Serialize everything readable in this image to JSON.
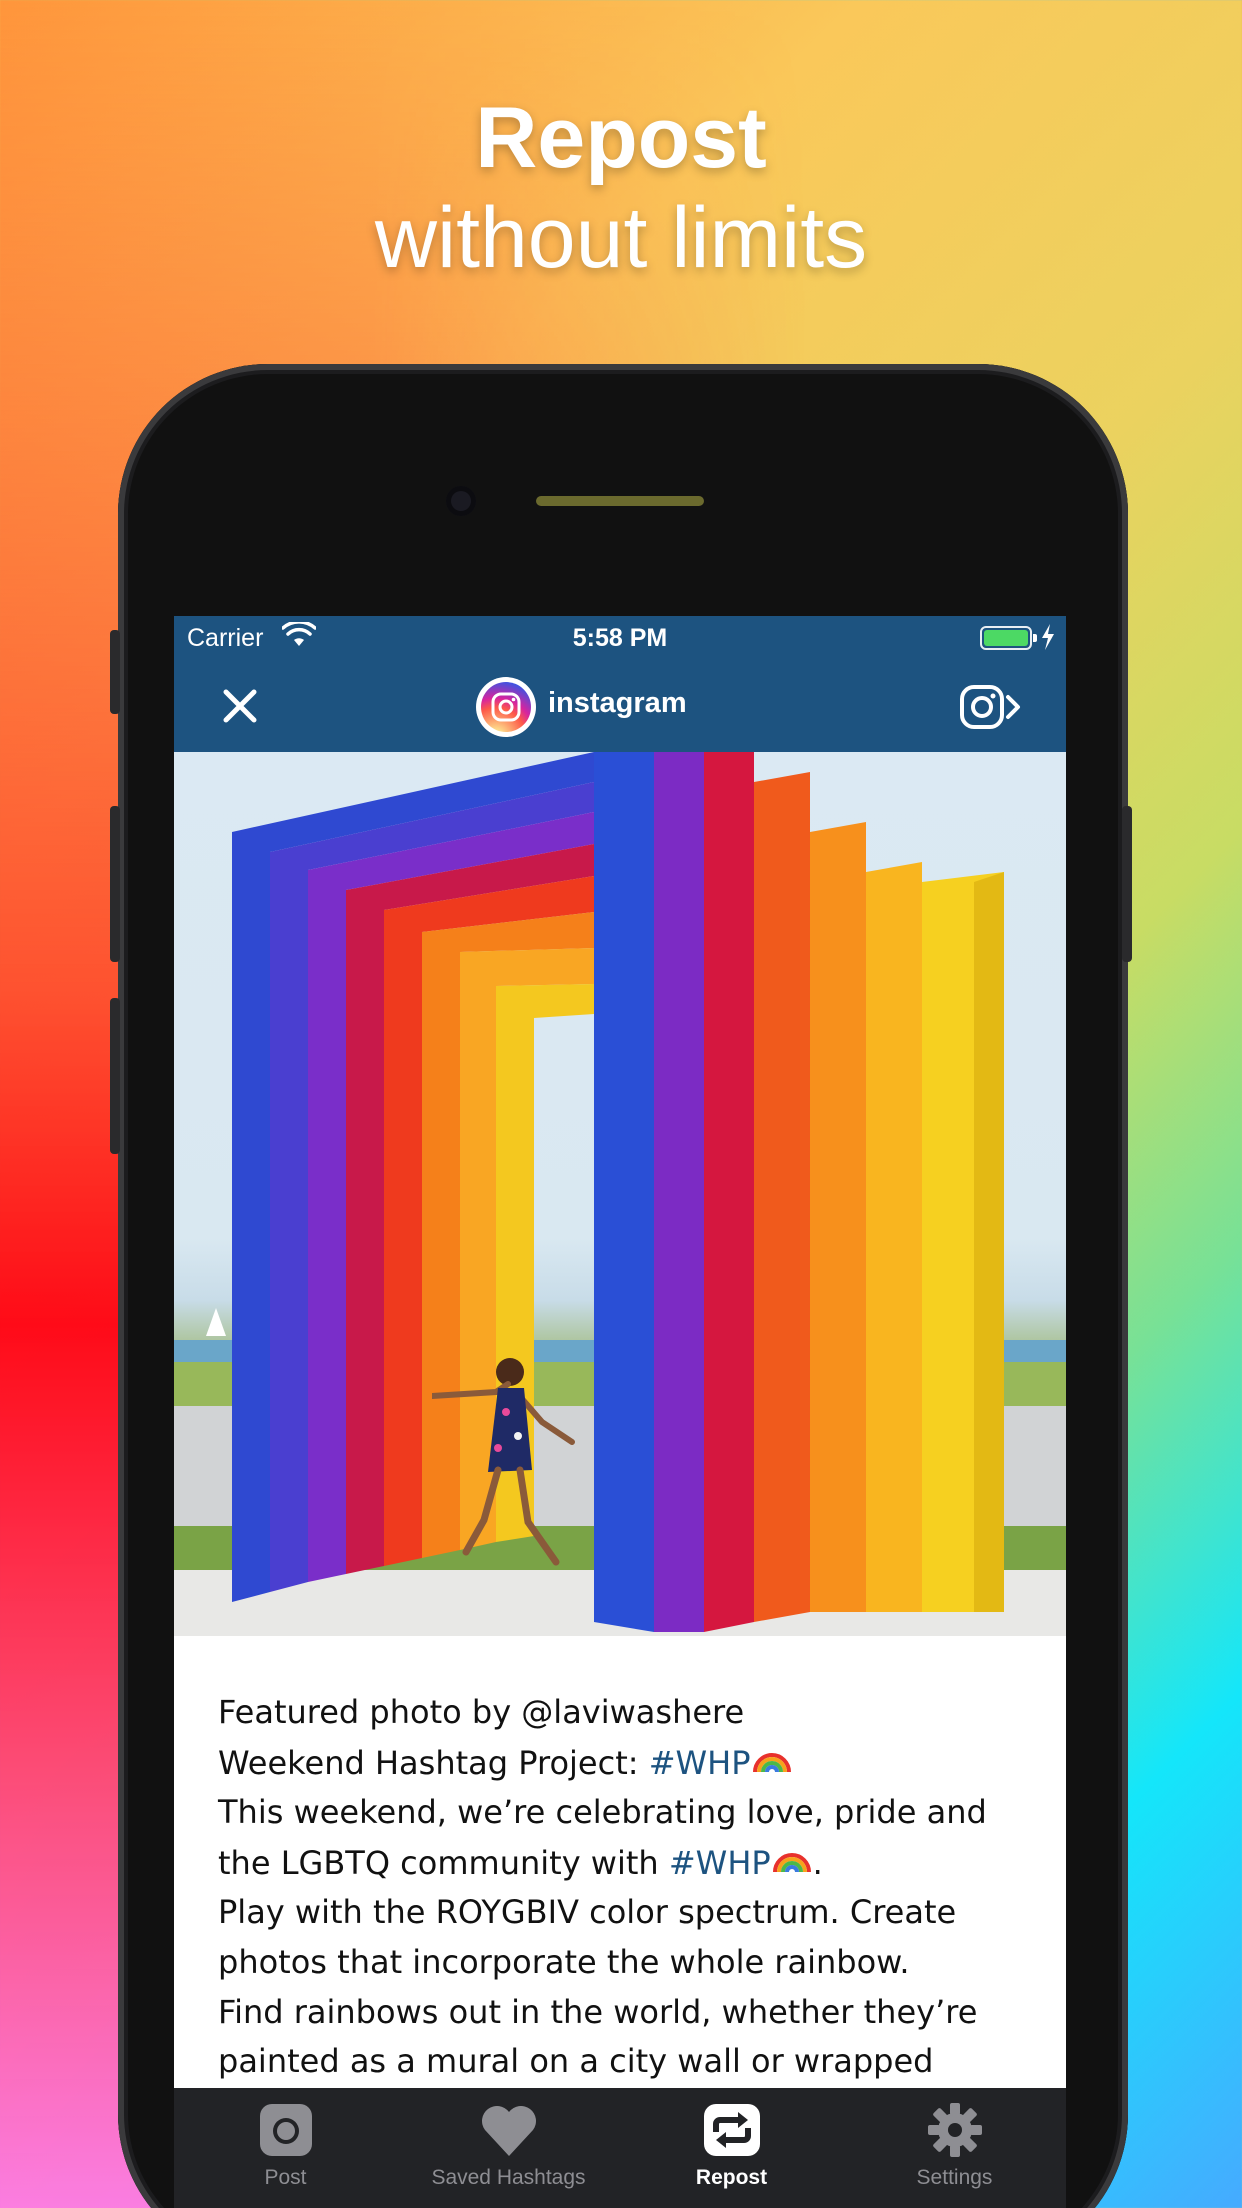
{
  "headline": {
    "line1": "Repost",
    "line2": "without limits"
  },
  "status_bar": {
    "carrier": "Carrier",
    "time": "5:58 PM"
  },
  "nav": {
    "username": "instagram",
    "close_icon": "close-icon",
    "share_icon": "instagram-share-icon"
  },
  "post": {
    "image_description_icon": "photo",
    "caption": {
      "line1": "Featured photo by @laviwashere",
      "line2_text": "Weekend Hashtag Project: ",
      "line2_tag": "#WHP",
      "line3": "This weekend, we’re celebrating love, pride and",
      "line4_text": "the LGBTQ community with ",
      "line4_tag": "#WHP",
      "line4_end": ".",
      "line5": "Play with the ROYGBIV color spectrum. Create",
      "line6": "photos that incorporate the whole rainbow.",
      "line7": "Find rainbows out in the world, whether they’re",
      "line8": "painted as a mural on a city wall or wrapped"
    }
  },
  "tabs": [
    {
      "label": "Post",
      "icon": "camera-icon",
      "active": false
    },
    {
      "label": "Saved Hashtags",
      "icon": "heart-icon",
      "active": false
    },
    {
      "label": "Repost",
      "icon": "repost-icon",
      "active": true
    },
    {
      "label": "Settings",
      "icon": "gear-icon",
      "active": false
    }
  ],
  "colors": {
    "nav_background": "#1d5380",
    "hashtag": "#1d5380",
    "tab_bar": "#222326",
    "tab_inactive": "#8e8e93",
    "tab_active": "#ffffff"
  }
}
